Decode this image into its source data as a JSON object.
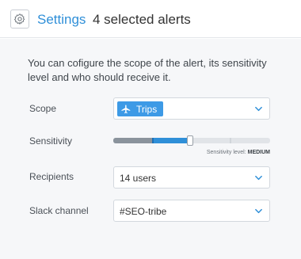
{
  "header": {
    "title_link": "Settings",
    "title_rest": "4 selected alerts",
    "icon": "gear-icon"
  },
  "intro_text": "You can cofigure the scope of the alert, its sensitivity level and who should receive it.",
  "scope": {
    "label": "Scope",
    "tag_label": "Trips",
    "tag_icon": "plane-icon"
  },
  "sensitivity": {
    "label": "Sensitivity",
    "caption_prefix": "Sensitivity level:",
    "level": "MEDIUM",
    "level_fraction": 0.5
  },
  "recipients": {
    "label": "Recipients",
    "value": "14 users"
  },
  "slack": {
    "label": "Slack channel",
    "value": "#SEO-tribe"
  },
  "colors": {
    "accent": "#2f8fd8",
    "tag_bg": "#3d9ae6",
    "panel_bg": "#f6f7f9"
  }
}
